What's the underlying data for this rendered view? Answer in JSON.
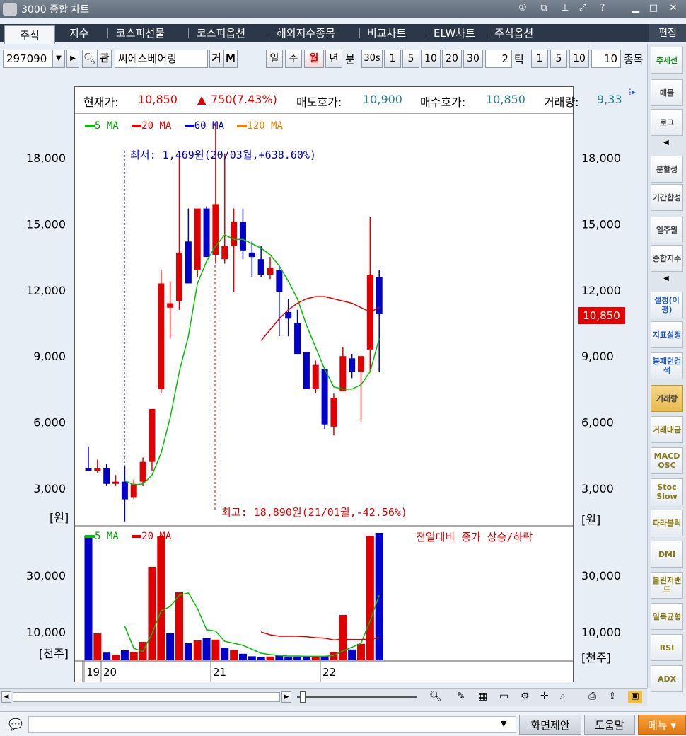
{
  "window": {
    "title": "3000 종합 차트"
  },
  "tabs": [
    "주식",
    "지수",
    "코스피선물",
    "코스피옵션",
    "해외지수종목",
    "비교차트",
    "ELW차트",
    "주식옵션"
  ],
  "edit_label": "편집",
  "toolbar": {
    "code": "297090",
    "name": "씨에스베어링",
    "gwan": "관",
    "ge": "거",
    "m": "M",
    "periods": [
      "일",
      "주",
      "월",
      "년",
      "분"
    ],
    "active_period": "월",
    "min_buttons": [
      "30s",
      "1",
      "5",
      "10",
      "20",
      "30"
    ],
    "min_value": "2",
    "tick_label": "틱",
    "tick_buttons": [
      "1",
      "5",
      "10"
    ],
    "tick_value": "10",
    "stock_label": "종목"
  },
  "side_buttons": [
    "추세선",
    "매물",
    "로그",
    "분할성",
    "기간합성",
    "일주월",
    "종합지수",
    "설정(이평)",
    "지표설정",
    "봉패턴검색",
    "거래량",
    "거래대금",
    "MACD OSC",
    "Stoc Slow",
    "파라볼릭",
    "DMI",
    "볼린저밴드",
    "일목균형",
    "RSI",
    "ADX"
  ],
  "info": {
    "cur_label": "현재가:",
    "cur_value": "10,850",
    "chg_value": "750(7.43%)",
    "ask_label": "매도호가:",
    "ask_value": "10,900",
    "bid_label": "매수호가:",
    "bid_value": "10,850",
    "vol_label": "거래량:",
    "vol_value": "9,33"
  },
  "legend_price": [
    "5 MA",
    "20 MA",
    "60 MA",
    "120 MA"
  ],
  "legend_volume": [
    "5 MA",
    "20 MA"
  ],
  "annotations": {
    "low": "최저: 1,469원(20/03월,+638.60%)",
    "high": "최고: 18,890원(21/01월,-42.56%)",
    "vol_note": "전일대비 종가 상승/하락"
  },
  "price_box": "10,850",
  "units": {
    "price": "[원]",
    "volume": "[천주]"
  },
  "bottom": {
    "screen_suggest": "화면제안",
    "help": "도움말",
    "menu": "메뉴"
  },
  "colors": {
    "up": "#e00000",
    "down": "#0000c8",
    "ma5": "#00c000",
    "ma20": "#e00000",
    "ma60": "#0000c8",
    "ma120": "#f08000"
  },
  "chart_data": [
    {
      "type": "candlestick",
      "title": "",
      "ylim": [
        700,
        19600
      ],
      "yticks": [
        3000,
        6000,
        9000,
        12000,
        15000,
        18000
      ],
      "ytick_labels": [
        "3,000",
        "6,000",
        "9,000",
        "12,000",
        "15,000",
        "18,000"
      ],
      "xtick_labels": [
        "19",
        "20",
        "21",
        "22"
      ],
      "candles": [
        {
          "o": 3900,
          "h": 4900,
          "l": 3800,
          "c": 3800
        },
        {
          "o": 3800,
          "h": 4300,
          "l": 3700,
          "c": 3900
        },
        {
          "o": 3900,
          "h": 4100,
          "l": 3100,
          "c": 3200
        },
        {
          "o": 3200,
          "h": 3600,
          "l": 3100,
          "c": 3300
        },
        {
          "o": 3300,
          "h": 4000,
          "l": 1500,
          "c": 2500
        },
        {
          "o": 2600,
          "h": 3400,
          "l": 2500,
          "c": 3200
        },
        {
          "o": 3300,
          "h": 4400,
          "l": 3100,
          "c": 4200
        },
        {
          "o": 4200,
          "h": 6600,
          "l": 3800,
          "c": 6600
        },
        {
          "o": 7500,
          "h": 12900,
          "l": 7300,
          "c": 12300
        },
        {
          "o": 11200,
          "h": 12400,
          "l": 9800,
          "c": 11400
        },
        {
          "o": 11500,
          "h": 18300,
          "l": 11100,
          "c": 13700
        },
        {
          "o": 14200,
          "h": 15700,
          "l": 12400,
          "c": 12300
        },
        {
          "o": 12900,
          "h": 15600,
          "l": 12600,
          "c": 15700
        },
        {
          "o": 15700,
          "h": 15800,
          "l": 13900,
          "c": 13500
        },
        {
          "o": 13600,
          "h": 19600,
          "l": 13200,
          "c": 15900
        },
        {
          "o": 13400,
          "h": 18200,
          "l": 13200,
          "c": 14000
        },
        {
          "o": 14000,
          "h": 15700,
          "l": 11900,
          "c": 15100
        },
        {
          "o": 15100,
          "h": 15700,
          "l": 13400,
          "c": 13800
        },
        {
          "o": 13700,
          "h": 14200,
          "l": 12600,
          "c": 13500
        },
        {
          "o": 13400,
          "h": 14000,
          "l": 12600,
          "c": 12700
        },
        {
          "o": 12700,
          "h": 13500,
          "l": 12500,
          "c": 13000
        },
        {
          "o": 12900,
          "h": 13100,
          "l": 9900,
          "c": 11900
        },
        {
          "o": 11000,
          "h": 11600,
          "l": 9900,
          "c": 10700
        },
        {
          "o": 10500,
          "h": 11100,
          "l": 9500,
          "c": 9100
        },
        {
          "o": 9200,
          "h": 9200,
          "l": 7500,
          "c": 7500
        },
        {
          "o": 7500,
          "h": 8800,
          "l": 7300,
          "c": 8600
        },
        {
          "o": 8400,
          "h": 8500,
          "l": 5700,
          "c": 5900
        },
        {
          "o": 5800,
          "h": 7300,
          "l": 5400,
          "c": 7100
        },
        {
          "o": 7400,
          "h": 9400,
          "l": 7400,
          "c": 9000
        },
        {
          "o": 8900,
          "h": 9100,
          "l": 8000,
          "c": 8300
        },
        {
          "o": 8300,
          "h": 9000,
          "l": 6000,
          "c": 9000
        },
        {
          "o": 9300,
          "h": 15300,
          "l": 8300,
          "c": 12700
        },
        {
          "o": 12600,
          "h": 12900,
          "l": 8300,
          "c": 10900
        }
      ],
      "ma5": [
        null,
        null,
        null,
        null,
        3350,
        3150,
        3200,
        3600,
        4600,
        6200,
        8300,
        9900,
        12300,
        13300,
        14000,
        14500,
        14300,
        14300,
        14100,
        13900,
        13600,
        13100,
        12400,
        11600,
        10400,
        9400,
        8400,
        7600,
        7500,
        7500,
        7700,
        8300,
        9800
      ],
      "ma20": [
        null,
        null,
        null,
        null,
        null,
        null,
        null,
        null,
        null,
        null,
        null,
        null,
        null,
        null,
        null,
        null,
        null,
        null,
        null,
        9700,
        10200,
        10700,
        11100,
        11400,
        11600,
        11700,
        11700,
        11600,
        11500,
        11400,
        11200,
        11000,
        11200
      ]
    },
    {
      "type": "bar",
      "title": "",
      "ylim": [
        0,
        46000
      ],
      "yticks": [
        10000,
        30000
      ],
      "ytick_labels": [
        "10,000",
        "30,000"
      ],
      "volumes": [
        44000,
        9500,
        2700,
        2000,
        3500,
        3000,
        6500,
        33000,
        44000,
        9500,
        24000,
        6000,
        7000,
        7800,
        7300,
        4500,
        3600,
        2300,
        1400,
        1200,
        1300,
        2000,
        1300,
        1300,
        1200,
        1300,
        1400,
        3000,
        16000,
        3800,
        5800,
        44000,
        45000
      ],
      "ma5": [
        null,
        null,
        null,
        null,
        12000,
        4200,
        3100,
        9500,
        17500,
        19000,
        23000,
        23800,
        18300,
        10800,
        10300,
        6700,
        6000,
        5300,
        3900,
        2500,
        2000,
        1700,
        1500,
        1500,
        1400,
        1400,
        1400,
        1700,
        3300,
        4600,
        6000,
        14000,
        23000
      ],
      "ma20": [
        null,
        null,
        null,
        null,
        null,
        null,
        null,
        null,
        null,
        null,
        null,
        null,
        null,
        null,
        null,
        null,
        null,
        null,
        null,
        10000,
        9000,
        8500,
        8500,
        8500,
        8300,
        8000,
        7800,
        7200,
        7400,
        7300,
        7300,
        7500,
        8000
      ]
    }
  ]
}
